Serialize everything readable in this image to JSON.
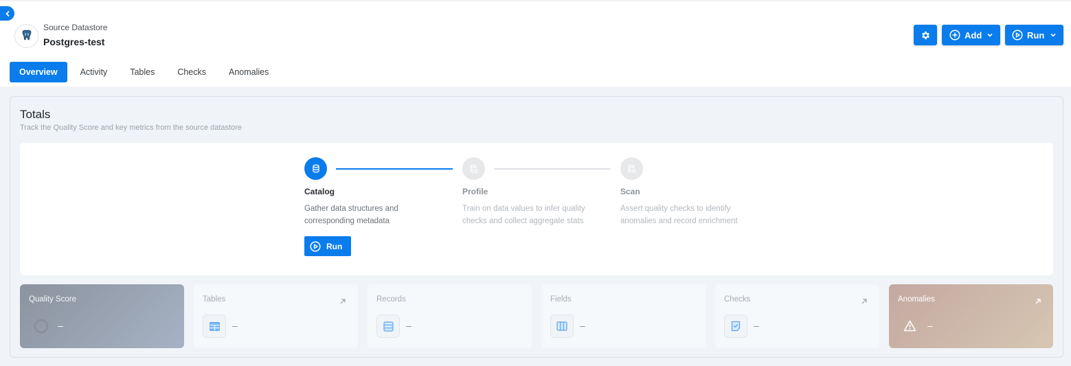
{
  "header": {
    "subtitle": "Source Datastore",
    "title": "Postgres-test",
    "logo_icon": "postgres-elephant-icon"
  },
  "actions": {
    "settings_icon": "gear-icon",
    "add_label": "Add",
    "run_label": "Run"
  },
  "tabs": [
    {
      "label": "Overview",
      "active": true
    },
    {
      "label": "Activity",
      "active": false
    },
    {
      "label": "Tables",
      "active": false
    },
    {
      "label": "Checks",
      "active": false
    },
    {
      "label": "Anomalies",
      "active": false
    }
  ],
  "totals": {
    "title": "Totals",
    "subtitle": "Track the Quality Score and key metrics from the source datastore"
  },
  "steps": [
    {
      "title": "Catalog",
      "desc_line1": "Gather data structures and",
      "desc_line2": "corresponding metadata",
      "active": true,
      "icon": "database-icon",
      "run_label": "Run"
    },
    {
      "title": "Profile",
      "desc_line1": "Train on data values to infer quality",
      "desc_line2": "checks and collect aggregate stats",
      "active": false,
      "icon": "database-settings-icon"
    },
    {
      "title": "Scan",
      "desc_line1": "Assert quality checks to identify",
      "desc_line2": "anomalies and record enrichment",
      "active": false,
      "icon": "database-search-icon"
    }
  ],
  "metrics": [
    {
      "label": "Quality Score",
      "value": "–"
    },
    {
      "label": "Tables",
      "value": "–"
    },
    {
      "label": "Records",
      "value": "–"
    },
    {
      "label": "Fields",
      "value": "–"
    },
    {
      "label": "Checks",
      "value": "–"
    },
    {
      "label": "Anomalies",
      "value": "–"
    }
  ],
  "colors": {
    "accent": "#0a7cec",
    "page_bg": "#f0f4f8"
  }
}
